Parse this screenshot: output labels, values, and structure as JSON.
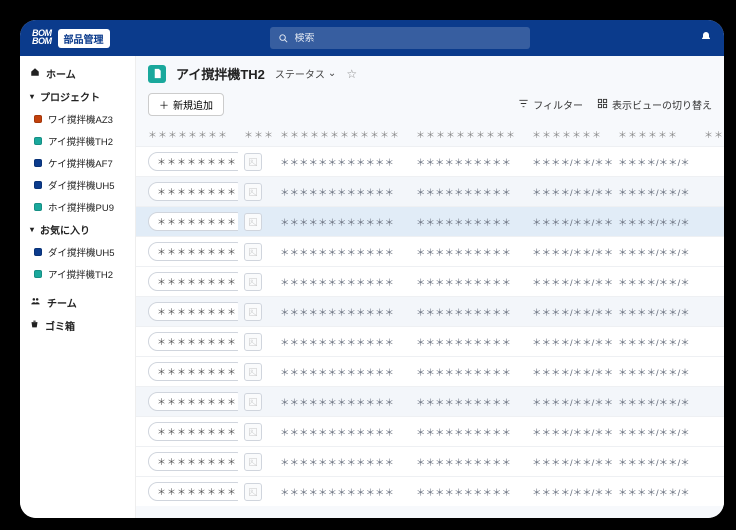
{
  "brand": {
    "line1": "BOM",
    "line2": "BOM",
    "badge": "部品管理"
  },
  "search": {
    "placeholder": "検索"
  },
  "sidebar": {
    "home": "ホーム",
    "projects_label": "プロジェクト",
    "projects": [
      {
        "label": "ワイ撹拌機AZ3",
        "color": "#c2410c"
      },
      {
        "label": "アイ撹拌機TH2",
        "color": "#1aa89c"
      },
      {
        "label": "ケイ撹拌機AF7",
        "color": "#0b3b8c"
      },
      {
        "label": "ダイ撹拌機UH5",
        "color": "#0b3b8c"
      },
      {
        "label": "ホイ撹拌機PU9",
        "color": "#1aa89c"
      }
    ],
    "favorites_label": "お気に入り",
    "favorites": [
      {
        "label": "ダイ撹拌機UH5",
        "color": "#0b3b8c"
      },
      {
        "label": "アイ撹拌機TH2",
        "color": "#1aa89c"
      }
    ],
    "team": "チーム",
    "trash": "ゴミ箱"
  },
  "page": {
    "title": "アイ撹拌機TH2",
    "status_label": "ステータス"
  },
  "toolbar": {
    "add": "新規追加",
    "filter": "フィルター",
    "view_switch": "表示ビューの切り替え"
  },
  "table": {
    "headers": [
      "＊＊＊＊＊＊＊＊",
      "＊＊＊",
      "＊＊＊＊＊＊＊＊＊＊＊＊",
      "＊＊＊＊＊＊＊＊＊＊",
      "＊＊＊＊＊＊＊",
      "＊＊＊＊＊＊",
      "＊＊＊＊＊"
    ],
    "rows": [
      {
        "c0": "＊＊＊＊＊＊＊＊",
        "c2": "＊＊＊＊＊＊＊＊＊＊＊＊",
        "c3": "＊＊＊＊＊＊＊＊＊＊",
        "c4": "＊＊＊＊/＊＊/＊＊",
        "c5": "＊＊＊＊/＊＊/＊",
        "band": false,
        "sel": false
      },
      {
        "c0": "＊＊＊＊＊＊＊＊",
        "c2": "＊＊＊＊＊＊＊＊＊＊＊＊",
        "c3": "＊＊＊＊＊＊＊＊＊＊",
        "c4": "＊＊＊＊/＊＊/＊＊",
        "c5": "＊＊＊＊/＊＊/＊",
        "band": true,
        "sel": false
      },
      {
        "c0": "＊＊＊＊＊＊＊＊",
        "c2": "＊＊＊＊＊＊＊＊＊＊＊＊",
        "c3": "＊＊＊＊＊＊＊＊＊＊",
        "c4": "＊＊＊＊/＊＊/＊＊",
        "c5": "＊＊＊＊/＊＊/＊",
        "band": false,
        "sel": true
      },
      {
        "c0": "＊＊＊＊＊＊＊＊",
        "c2": "＊＊＊＊＊＊＊＊＊＊＊＊",
        "c3": "＊＊＊＊＊＊＊＊＊＊",
        "c4": "＊＊＊＊/＊＊/＊＊",
        "c5": "＊＊＊＊/＊＊/＊",
        "band": false,
        "sel": false
      },
      {
        "c0": "＊＊＊＊＊＊＊＊",
        "c2": "＊＊＊＊＊＊＊＊＊＊＊＊",
        "c3": "＊＊＊＊＊＊＊＊＊＊",
        "c4": "＊＊＊＊/＊＊/＊＊",
        "c5": "＊＊＊＊/＊＊/＊",
        "band": false,
        "sel": false
      },
      {
        "c0": "＊＊＊＊＊＊＊＊",
        "c2": "＊＊＊＊＊＊＊＊＊＊＊＊",
        "c3": "＊＊＊＊＊＊＊＊＊＊",
        "c4": "＊＊＊＊/＊＊/＊＊",
        "c5": "＊＊＊＊/＊＊/＊",
        "band": true,
        "sel": false
      },
      {
        "c0": "＊＊＊＊＊＊＊＊",
        "c2": "＊＊＊＊＊＊＊＊＊＊＊＊",
        "c3": "＊＊＊＊＊＊＊＊＊＊",
        "c4": "＊＊＊＊/＊＊/＊＊",
        "c5": "＊＊＊＊/＊＊/＊",
        "band": false,
        "sel": false
      },
      {
        "c0": "＊＊＊＊＊＊＊＊",
        "c2": "＊＊＊＊＊＊＊＊＊＊＊＊",
        "c3": "＊＊＊＊＊＊＊＊＊＊",
        "c4": "＊＊＊＊/＊＊/＊＊",
        "c5": "＊＊＊＊/＊＊/＊",
        "band": false,
        "sel": false
      },
      {
        "c0": "＊＊＊＊＊＊＊＊",
        "c2": "＊＊＊＊＊＊＊＊＊＊＊＊",
        "c3": "＊＊＊＊＊＊＊＊＊＊",
        "c4": "＊＊＊＊/＊＊/＊＊",
        "c5": "＊＊＊＊/＊＊/＊",
        "band": true,
        "sel": false
      },
      {
        "c0": "＊＊＊＊＊＊＊＊",
        "c2": "＊＊＊＊＊＊＊＊＊＊＊＊",
        "c3": "＊＊＊＊＊＊＊＊＊＊",
        "c4": "＊＊＊＊/＊＊/＊＊",
        "c5": "＊＊＊＊/＊＊/＊",
        "band": false,
        "sel": false
      },
      {
        "c0": "＊＊＊＊＊＊＊＊",
        "c2": "＊＊＊＊＊＊＊＊＊＊＊＊",
        "c3": "＊＊＊＊＊＊＊＊＊＊",
        "c4": "＊＊＊＊/＊＊/＊＊",
        "c5": "＊＊＊＊/＊＊/＊",
        "band": false,
        "sel": false
      },
      {
        "c0": "＊＊＊＊＊＊＊＊",
        "c2": "＊＊＊＊＊＊＊＊＊＊＊＊",
        "c3": "＊＊＊＊＊＊＊＊＊＊",
        "c4": "＊＊＊＊/＊＊/＊＊",
        "c5": "＊＊＊＊/＊＊/＊",
        "band": false,
        "sel": false
      }
    ]
  }
}
